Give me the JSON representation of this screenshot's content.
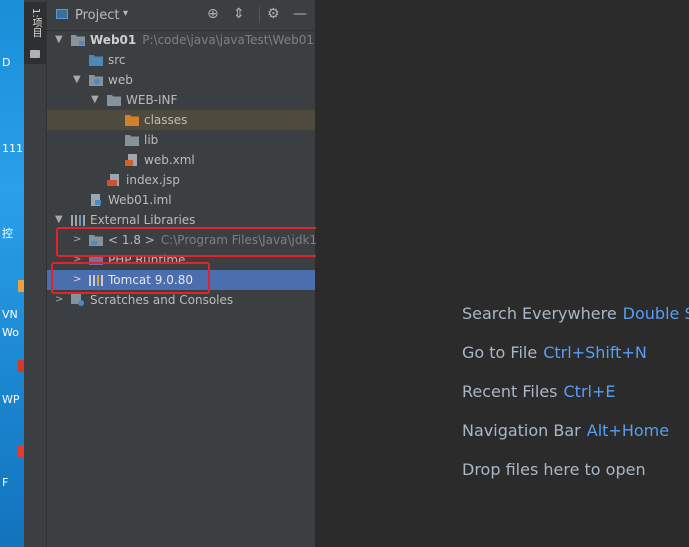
{
  "desktop": {
    "labels": [
      "D",
      "111",
      "控",
      "VN",
      "Wo",
      "WP",
      "F"
    ]
  },
  "tool_strip": {
    "tab_label": "1:项目"
  },
  "panel": {
    "title": "Project",
    "caret": "▾",
    "buttons": [
      "⊕",
      "⇕",
      "⚙",
      "—"
    ]
  },
  "tree": {
    "project_name": "Web01",
    "project_path": "P:\\code\\java\\javaTest\\Web01",
    "src": "src",
    "web": "web",
    "webinf": "WEB-INF",
    "classes": "classes",
    "lib": "lib",
    "webxml": "web.xml",
    "indexjsp": "index.jsp",
    "iml": "Web01.iml",
    "external_libraries": "External Libraries",
    "jdk_name": "< 1.8 >",
    "jdk_path": "C:\\Program Files\\Java\\jdk1",
    "php_runtime": "PHP Runtime",
    "tomcat": "Tomcat 9.0.80",
    "scratches": "Scratches and Consoles"
  },
  "editor": {
    "hints": [
      {
        "label": "Search Everywhere",
        "key": "Double Sh"
      },
      {
        "label": "Go to File",
        "key": "Ctrl+Shift+N"
      },
      {
        "label": "Recent Files",
        "key": "Ctrl+E"
      },
      {
        "label": "Navigation Bar",
        "key": "Alt+Home"
      }
    ],
    "drop_hint": "Drop files here to open"
  },
  "colors": {
    "accent_blue": "#589df6",
    "selection": "#4b6eaf",
    "annotation_red": "#e3232c",
    "folder_orange": "#d0822a"
  }
}
